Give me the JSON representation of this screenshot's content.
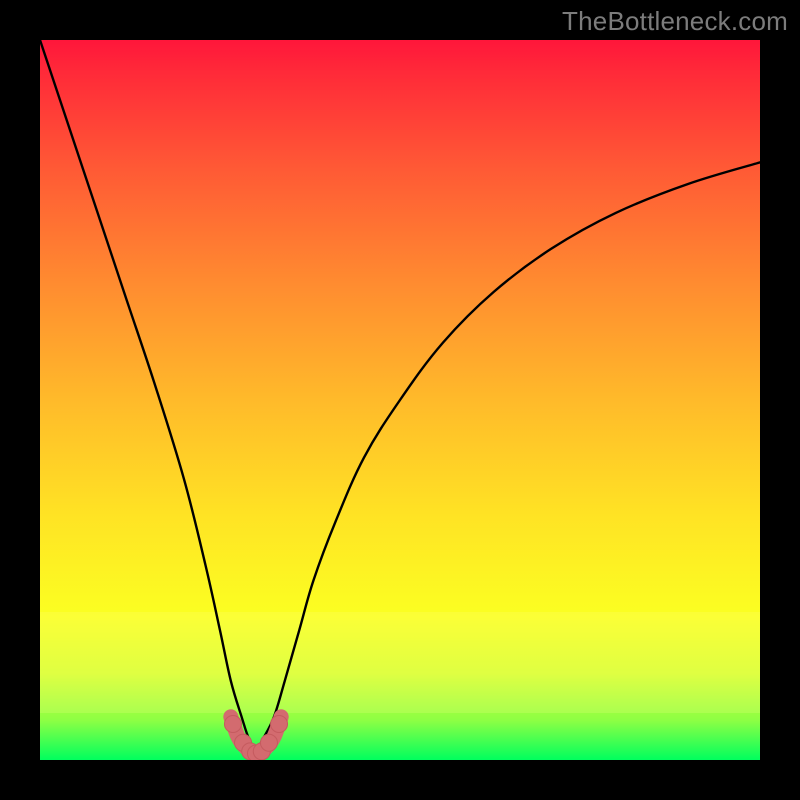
{
  "watermark": "TheBottleneck.com",
  "colors": {
    "frame": "#000000",
    "curve": "#000000",
    "marker_fill": "#d36b6f",
    "marker_stroke": "#c55b5f",
    "gradient_top": "#ff163a",
    "gradient_bottom": "#00ff5e"
  },
  "chart_data": {
    "type": "line",
    "title": "",
    "xlabel": "",
    "ylabel": "",
    "xlim": [
      0,
      100
    ],
    "ylim": [
      0,
      100
    ],
    "grid": false,
    "legend": false,
    "series": [
      {
        "name": "bottleneck-curve",
        "x": [
          0,
          4,
          8,
          12,
          16,
          20,
          23,
          25,
          26.5,
          28,
          29,
          30,
          31,
          32.5,
          34,
          36,
          38,
          41,
          45,
          50,
          56,
          63,
          71,
          80,
          90,
          100
        ],
        "y": [
          100,
          88,
          76,
          64,
          52,
          39,
          27,
          18,
          11,
          6,
          3,
          1.5,
          3,
          6,
          11,
          18,
          25,
          33,
          42,
          50,
          58,
          65,
          71,
          76,
          80,
          83
        ]
      },
      {
        "name": "bottom-markers",
        "x": [
          26.8,
          28.2,
          29.2,
          30,
          30.8,
          31.8,
          33.2
        ],
        "y": [
          5.0,
          2.4,
          1.2,
          0.9,
          1.2,
          2.4,
          5.0
        ]
      },
      {
        "name": "bottom-u-shape",
        "x": [
          26.5,
          27.5,
          28.5,
          29.3,
          30,
          30.7,
          31.5,
          32.5,
          33.5
        ],
        "y": [
          6,
          3.2,
          1.8,
          1.1,
          0.9,
          1.1,
          1.8,
          3.2,
          6
        ]
      }
    ]
  }
}
